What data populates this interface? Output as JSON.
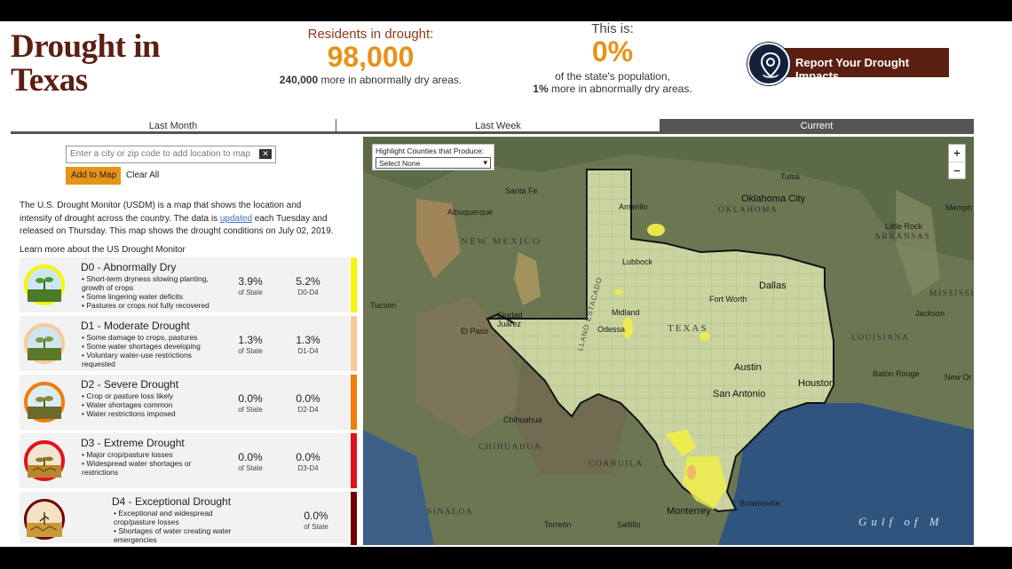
{
  "header": {
    "title_line1": "Drought in",
    "title_line2": "Texas",
    "residents_label": "Residents in drought:",
    "residents_value": "98,000",
    "residents_sub_bold": "240,000",
    "residents_sub_rest": " more in abnormally dry areas.",
    "pct_label": "This is:",
    "pct_value": "0%",
    "pct_sub1": "of the state's population,",
    "pct_sub2_bold": "1%",
    "pct_sub2_rest": " more in abnormally dry areas.",
    "report_button": "Report Your Drought Impacts"
  },
  "tabs": [
    {
      "label": "Last Month",
      "active": false
    },
    {
      "label": "Last Week",
      "active": false
    },
    {
      "label": "Current",
      "active": true
    }
  ],
  "search": {
    "placeholder": "Enter a city or zip code to add location to map",
    "add_button": "Add to Map",
    "clear_button": "Clear All"
  },
  "description": {
    "part1": "The U.S. Drought Monitor (USDM) is a map that shows the location and intensity of drought across the country. The data is ",
    "link": "updated",
    "part2": " each Tuesday and released on Thursday. This map shows the drought conditions on July 02, 2019.",
    "learn_more": "Learn more about the US Drought Monitor"
  },
  "categories": [
    {
      "title": "D0 - Abnormally Dry",
      "bullets": [
        "Short-term dryness slowing planting, growth of crops",
        "Some lingering water deficits",
        "Pastures or crops not fully recovered"
      ],
      "pct_state": "3.9%",
      "pct_state_label": "of State",
      "pct_range": "5.2%",
      "pct_range_label": "D0-D4",
      "color": "#f5f50a",
      "icon_ring": "#f5f50a"
    },
    {
      "title": "D1 - Moderate Drought",
      "bullets": [
        "Some damage to crops, pastures",
        "Some water shortages developing",
        "Voluntary water-use restrictions requested"
      ],
      "pct_state": "1.3%",
      "pct_state_label": "of State",
      "pct_range": "1.3%",
      "pct_range_label": "D1-D4",
      "color": "#f9c99a",
      "icon_ring": "#f9c99a"
    },
    {
      "title": "D2 - Severe Drought",
      "bullets": [
        "Crop or pasture loss likely",
        "Water shortages common",
        "Water restrictions imposed"
      ],
      "pct_state": "0.0%",
      "pct_state_label": "of State",
      "pct_range": "0.0%",
      "pct_range_label": "D2-D4",
      "color": "#f27d0c",
      "icon_ring": "#f27d0c"
    },
    {
      "title": "D3 - Extreme Drought",
      "bullets": [
        "Major crop/pasture losses",
        "Widespread water shortages or restrictions"
      ],
      "pct_state": "0.0%",
      "pct_state_label": "of State",
      "pct_range": "0.0%",
      "pct_range_label": "D3-D4",
      "color": "#e0131a",
      "icon_ring": "#e0131a"
    },
    {
      "title": "D4 - Exceptional Drought",
      "bullets": [
        "Exceptional and widespread crop/pasture losses",
        "Shortages of water creating water emergencies"
      ],
      "pct_state": "",
      "pct_state_label": "",
      "pct_range": "0.0%",
      "pct_range_label": "of State",
      "color": "#730000",
      "icon_ring": "#730000"
    }
  ],
  "map": {
    "highlight_label": "Highlight Counties that Produce:",
    "highlight_value": "Select None",
    "zoom_in": "+",
    "zoom_out": "−",
    "labels": {
      "new_mexico": "NEW MEXICO",
      "oklahoma": "OKLAHOMA",
      "arkansas": "ARKANSAS",
      "texas": "TEXAS",
      "louisiana": "LOUISIANA",
      "mississippi": "MISSISSIPI",
      "chihuahua": "CHIHUAHUA",
      "coahuila": "COAHUILA",
      "sinaloa": "SINALOA",
      "gulf": "Gulf of M",
      "llano": "LLANO ESTACADO",
      "santa_fe": "Santa Fe",
      "albuquerque": "Albuquerque",
      "tulsa": "Tulsa",
      "oklahoma_city": "Oklahoma City",
      "memphis": "Memph",
      "little_rock": "Little Rock",
      "amarillo": "Amarillo",
      "lubbock": "Lubbock",
      "dallas": "Dallas",
      "fort_worth": "Fort Worth",
      "tucson": "Tucson",
      "ciudad_juarez": "Ciudad Juárez",
      "el_paso": "El Paso",
      "midland": "Midland",
      "odessa": "Odessa",
      "jackson": "Jackson",
      "austin": "Austin",
      "houston": "Houston",
      "san_antonio": "San Antonio",
      "baton_rouge": "Baton Rouge",
      "new_orleans": "New Or",
      "chihuahua_city": "Chihuahua",
      "monterrey": "Monterrey",
      "saltillo": "Saltillo",
      "torreon": "Torreón",
      "brownsville": "Brownsville"
    }
  }
}
